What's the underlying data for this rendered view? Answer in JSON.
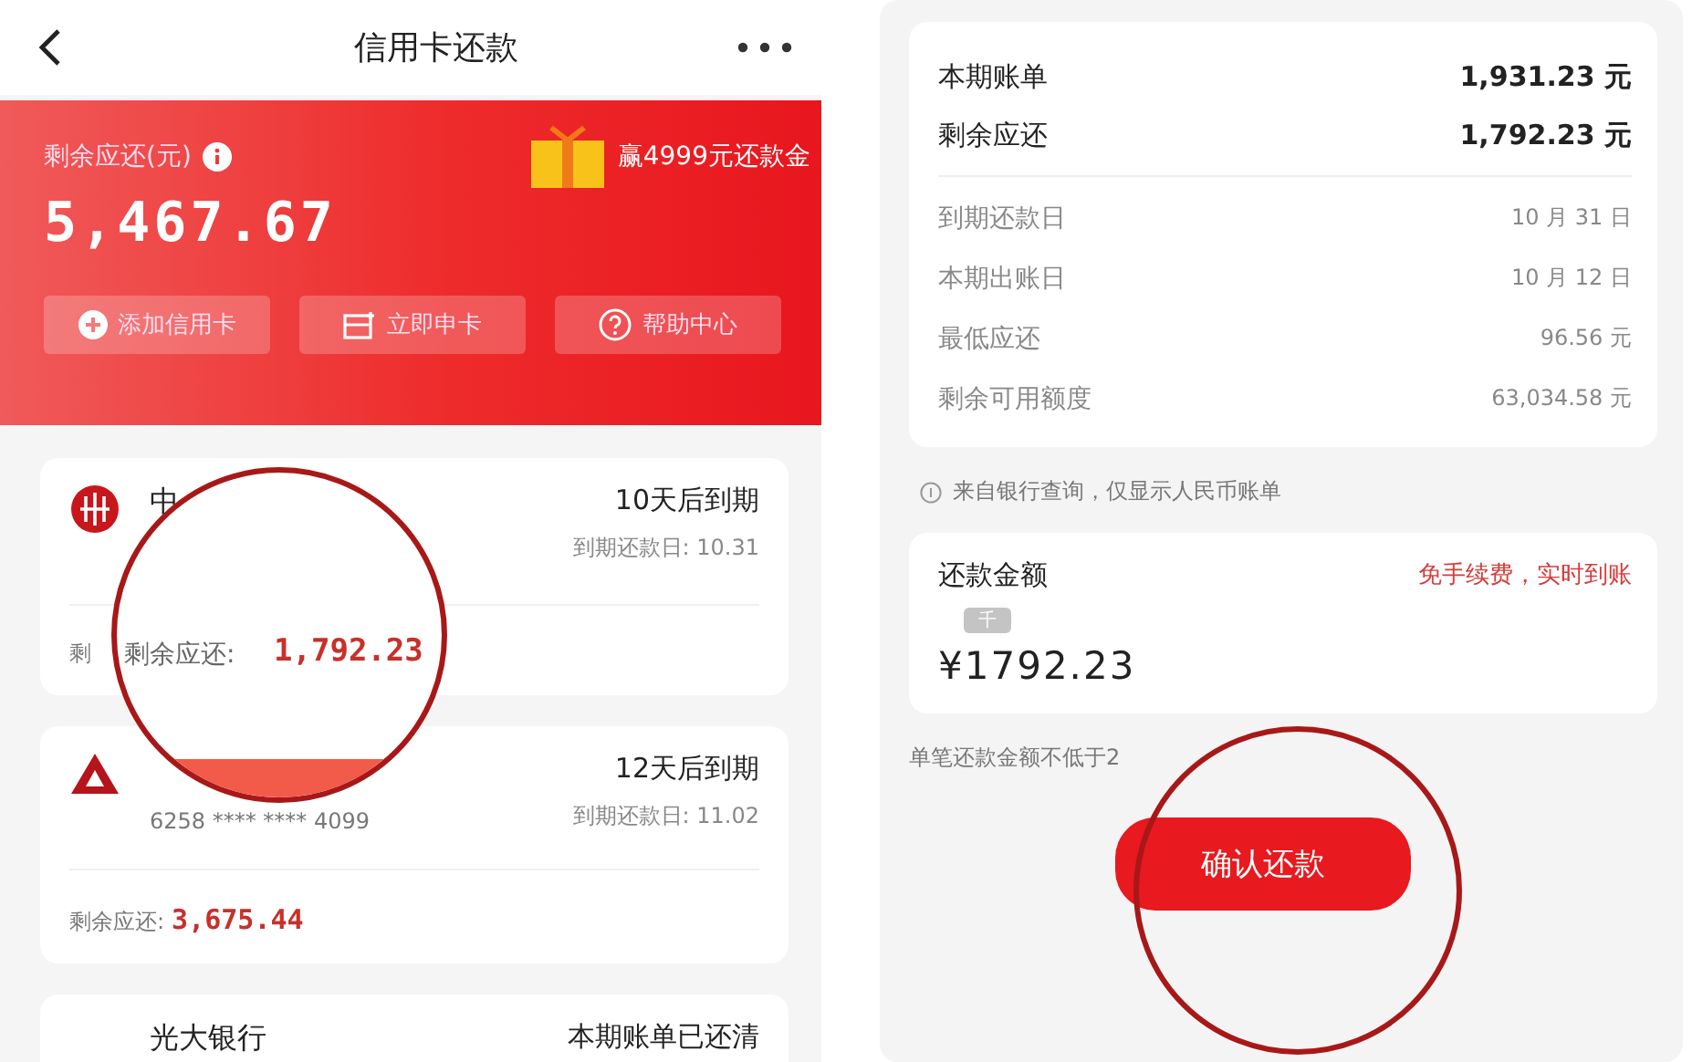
{
  "left_screen": {
    "header": {
      "title": "信用卡还款"
    },
    "banner": {
      "label": "剩余应还(元)",
      "amount": "5,467.67",
      "promo": "赢4999元还款金",
      "actions": [
        {
          "kind": "add",
          "label": "添加信用卡"
        },
        {
          "kind": "card",
          "label": "立即申卡"
        },
        {
          "kind": "help",
          "label": "帮助中心"
        }
      ]
    },
    "cards": [
      {
        "kind": "rings",
        "bank": "中",
        "due": "10天后到期",
        "due_date": "到期还款日: 10.31",
        "remaining_label": "剩"
      },
      {
        "kind": "triangle",
        "card_number": "6258 **** **** 4099",
        "due": "12天后到期",
        "due_date": "到期还款日: 11.02",
        "remaining_label": "剩余应还:",
        "remaining": "3,675.44"
      },
      {
        "kind": "plain",
        "bank": "光大银行",
        "due": "本期账单已还清"
      }
    ],
    "magnifier": {
      "label": "剩余应还:",
      "amount": "1,792.23"
    }
  },
  "right_screen": {
    "bill_rows": [
      {
        "kind": "primary",
        "label": "本期账单",
        "value": "1,931.23 元"
      },
      {
        "kind": "primary",
        "label": "剩余应还",
        "value": "1,792.23 元"
      },
      {
        "kind": "secondary",
        "label": "到期还款日",
        "value": "10 月 31 日"
      },
      {
        "kind": "secondary",
        "label": "本期出账日",
        "value": "10 月 12 日"
      },
      {
        "kind": "secondary",
        "label": "最低应还",
        "value": "96.56 元"
      },
      {
        "kind": "secondary",
        "label": "剩余可用额度",
        "value": "63,034.58 元"
      }
    ],
    "source_note": "来自银行查询，仅显示人民币账单",
    "payment": {
      "label": "还款金额",
      "tag": "免手续费，实时到账",
      "unit_tip": "千",
      "amount": "¥1792.23"
    },
    "min_note": "单笔还款金额不低于2",
    "confirm_button": "确认还款"
  }
}
